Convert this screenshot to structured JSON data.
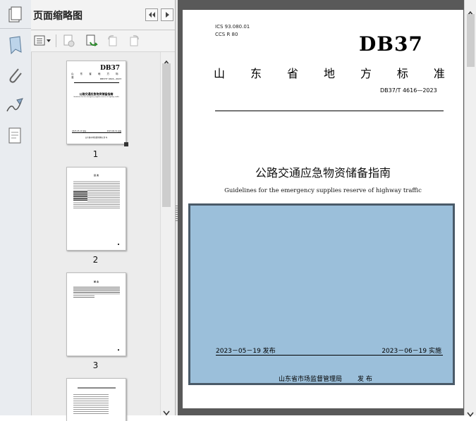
{
  "panel": {
    "title": "页面缩略图"
  },
  "thumbnails": [
    {
      "label": "1"
    },
    {
      "label": "2"
    },
    {
      "label": "3"
    }
  ],
  "thumb1": {
    "logo": "DB37",
    "std_no": "DB37/T 4616—2023",
    "title": "公路交通应急物资储备指南",
    "subtitle": "Guidelines for the emergency supplies reserve of highway traffic",
    "pub_date": "2023-05-19 发布",
    "impl_date": "2023-06-19 实施",
    "publisher": "山东省市场监督管理局 发 布"
  },
  "thumb2": {
    "heading": "目 次"
  },
  "thumb3": {
    "heading": "前 言"
  },
  "doc": {
    "ics": "ICS  93.080.01",
    "ccs": "CCS  R 80",
    "logo": "DB37",
    "province_chars": [
      "山",
      "东",
      "省",
      "地",
      "方",
      "标",
      "准"
    ],
    "std_no": "DB37/T 4616—2023",
    "title": "公路交通应急物资储备指南",
    "subtitle": "Guidelines for the emergency supplies reserve of highway traffic",
    "pub_date": "2023－05－19 发布",
    "impl_date": "2023－06－19 实施",
    "publisher": "山东省市场监督管理局",
    "publish": "发  布"
  },
  "colors": {
    "cover_fill": "#9bbfda",
    "cover_border": "#4a5a68",
    "doc_bg": "#595959"
  }
}
